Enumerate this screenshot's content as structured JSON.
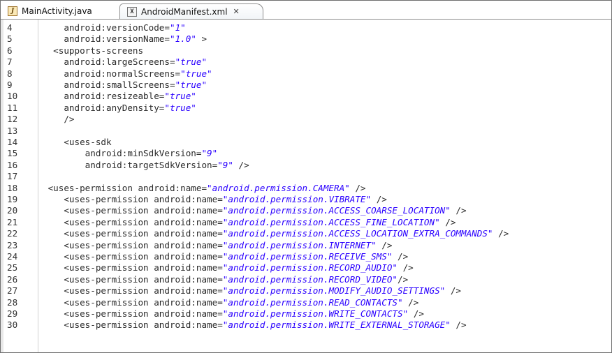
{
  "tabs": [
    {
      "label": "MainActivity.java",
      "icon": "java-file-icon",
      "active": false
    },
    {
      "label": "AndroidManifest.xml",
      "icon": "xml-file-icon",
      "active": true,
      "close": "✕"
    }
  ],
  "colors": {
    "string": "#2a00ff",
    "text": "#2a2a2a",
    "line_number": "#333333"
  },
  "lines": [
    {
      "n": "4",
      "t": [
        [
          "    android:versionCode=",
          ""
        ],
        [
          "\"1\"",
          "str"
        ]
      ]
    },
    {
      "n": "5",
      "t": [
        [
          "    android:versionName=",
          ""
        ],
        [
          "\"1.0\"",
          "str"
        ],
        [
          " >",
          ""
        ]
      ]
    },
    {
      "n": "6",
      "t": [
        [
          "  <supports-screens",
          ""
        ]
      ]
    },
    {
      "n": "7",
      "t": [
        [
          "    android:largeScreens=",
          ""
        ],
        [
          "\"true\"",
          "str"
        ]
      ]
    },
    {
      "n": "8",
      "t": [
        [
          "    android:normalScreens=",
          ""
        ],
        [
          "\"true\"",
          "str"
        ]
      ]
    },
    {
      "n": "9",
      "t": [
        [
          "    android:smallScreens=",
          ""
        ],
        [
          "\"true\"",
          "str"
        ]
      ]
    },
    {
      "n": "10",
      "t": [
        [
          "    android:resizeable=",
          ""
        ],
        [
          "\"true\"",
          "str"
        ]
      ]
    },
    {
      "n": "11",
      "t": [
        [
          "    android:anyDensity=",
          ""
        ],
        [
          "\"true\"",
          "str"
        ]
      ]
    },
    {
      "n": "12",
      "t": [
        [
          "    />",
          ""
        ]
      ]
    },
    {
      "n": "13",
      "t": []
    },
    {
      "n": "14",
      "t": [
        [
          "    <uses-sdk",
          ""
        ]
      ]
    },
    {
      "n": "15",
      "t": [
        [
          "        android:minSdkVersion=",
          ""
        ],
        [
          "\"9\"",
          "str"
        ]
      ]
    },
    {
      "n": "16",
      "t": [
        [
          "        android:targetSdkVersion=",
          ""
        ],
        [
          "\"9\"",
          "str"
        ],
        [
          " />",
          ""
        ]
      ]
    },
    {
      "n": "17",
      "t": []
    },
    {
      "n": "18",
      "t": [
        [
          " <uses-permission android:name=",
          ""
        ],
        [
          "\"android.permission.CAMERA\"",
          "str"
        ],
        [
          " />",
          ""
        ]
      ]
    },
    {
      "n": "19",
      "t": [
        [
          "    <uses-permission android:name=",
          ""
        ],
        [
          "\"android.permission.VIBRATE\"",
          "str"
        ],
        [
          " />",
          ""
        ]
      ]
    },
    {
      "n": "20",
      "t": [
        [
          "    <uses-permission android:name=",
          ""
        ],
        [
          "\"android.permission.ACCESS_COARSE_LOCATION\"",
          "str"
        ],
        [
          " />",
          ""
        ]
      ]
    },
    {
      "n": "21",
      "t": [
        [
          "    <uses-permission android:name=",
          ""
        ],
        [
          "\"android.permission.ACCESS_FINE_LOCATION\"",
          "str"
        ],
        [
          " />",
          ""
        ]
      ]
    },
    {
      "n": "22",
      "t": [
        [
          "    <uses-permission android:name=",
          ""
        ],
        [
          "\"android.permission.ACCESS_LOCATION_EXTRA_COMMANDS\"",
          "str"
        ],
        [
          " />",
          ""
        ]
      ]
    },
    {
      "n": "23",
      "t": [
        [
          "    <uses-permission android:name=",
          ""
        ],
        [
          "\"android.permission.INTERNET\"",
          "str"
        ],
        [
          " />",
          ""
        ]
      ]
    },
    {
      "n": "24",
      "t": [
        [
          "    <uses-permission android:name=",
          ""
        ],
        [
          "\"android.permission.RECEIVE_SMS\"",
          "str"
        ],
        [
          " />",
          ""
        ]
      ]
    },
    {
      "n": "25",
      "t": [
        [
          "    <uses-permission android:name=",
          ""
        ],
        [
          "\"android.permission.RECORD_AUDIO\"",
          "str"
        ],
        [
          " />",
          ""
        ]
      ]
    },
    {
      "n": "26",
      "t": [
        [
          "    <uses-permission android:name=",
          ""
        ],
        [
          "\"android.permission.RECORD_VIDEO\"",
          "str"
        ],
        [
          "/>",
          ""
        ]
      ]
    },
    {
      "n": "27",
      "t": [
        [
          "    <uses-permission android:name=",
          ""
        ],
        [
          "\"android.permission.MODIFY_AUDIO_SETTINGS\"",
          "str"
        ],
        [
          " />",
          ""
        ]
      ]
    },
    {
      "n": "28",
      "t": [
        [
          "    <uses-permission android:name=",
          ""
        ],
        [
          "\"android.permission.READ_CONTACTS\"",
          "str"
        ],
        [
          " />",
          ""
        ]
      ]
    },
    {
      "n": "29",
      "t": [
        [
          "    <uses-permission android:name=",
          ""
        ],
        [
          "\"android.permission.WRITE_CONTACTS\"",
          "str"
        ],
        [
          " />",
          ""
        ]
      ]
    },
    {
      "n": "30",
      "t": [
        [
          "    <uses-permission android:name=",
          ""
        ],
        [
          "\"android.permission.WRITE_EXTERNAL_STORAGE\"",
          "str"
        ],
        [
          " />",
          ""
        ]
      ]
    }
  ]
}
